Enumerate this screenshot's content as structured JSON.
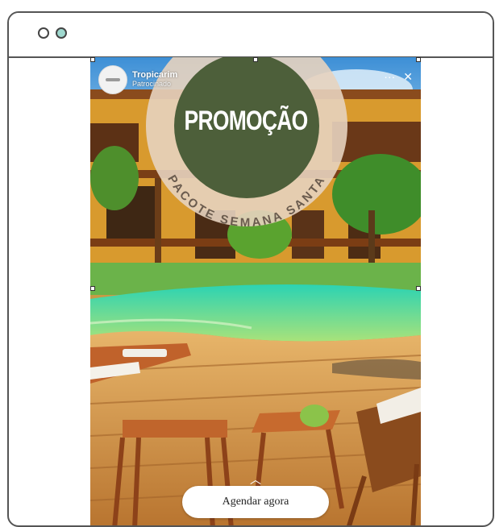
{
  "window": {
    "dots": [
      "close",
      "expand"
    ]
  },
  "ad": {
    "brand_name": "Tropicarim",
    "brand_subtitle": "Patrocinado",
    "more_glyph": "···",
    "close_glyph": "✕",
    "badge_title": "PROMOÇÃO",
    "badge_arc_text": "PACOTE SEMANA SANTA",
    "cta_label": "Agendar agora",
    "colors": {
      "badge_green": "#4d5f3a",
      "badge_ring": "#e7d3bf",
      "arc_text": "#6a5b4e"
    }
  }
}
